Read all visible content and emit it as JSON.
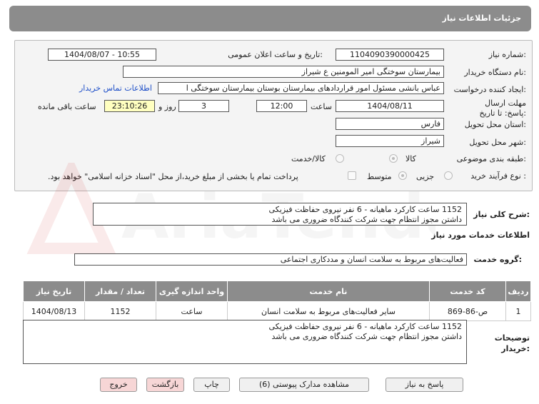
{
  "header": {
    "title": "جزئیات اطلاعات نیاز"
  },
  "fields": {
    "need_number_label": "شماره نیاز:",
    "need_number": "1104090390000425",
    "announce_label": "تاریخ و ساعت اعلان عمومی:",
    "announce_value": "1404/08/07 - 10:55",
    "buyer_org_label": "نام دستگاه خریدار:",
    "buyer_org": "بیمارستان سوختگی امیر المومنین  ع  شیراز",
    "requester_label": "ایجاد کننده درخواست:",
    "requester": "عباس بانشی مسئول امور قراردادهای بیمارستان بوستان بیمارستان سوختگی ا",
    "contact_link": "اطلاعات تماس خریدار",
    "deadline_label": "مهلت ارسال پاسخ: تا تاریخ:",
    "deadline_date": "1404/08/11",
    "time_label": "ساعت",
    "deadline_time": "12:00",
    "days_value": "3",
    "days_label": "روز و",
    "countdown": "23:10:26",
    "remaining_label": "ساعت باقی مانده",
    "province_label": "استان محل تحویل:",
    "province": "فارس",
    "city_label": "شهر محل تحویل:",
    "city": "شیراز",
    "category_label": "طبقه بندی موضوعی:",
    "cat_goods": "کالا",
    "cat_goods_service": "کالا/خدمت",
    "process_label": "نوع فرآیند خرید :",
    "proc_partial": "جزیی",
    "proc_medium": "متوسط",
    "treasury_note": "پرداخت تمام یا بخشی از مبلغ خرید،از محل \"اسناد خزانه اسلامی\" خواهد بود."
  },
  "summary": {
    "label": "شرح کلی نیاز:",
    "line1": "1152 ساعت کارکرد ماهیانه - 6 نفر نیروی حفاظت فیزیکی",
    "line2": "داشتن مجوز انتظام جهت شرکت کنندگاه ضروری می باشد"
  },
  "services": {
    "section_title": "اطلاعات خدمات مورد نیاز",
    "group_label": "گروه خدمت:",
    "group_value": "فعالیت‌های مربوط به سلامت انسان و مددکاری اجتماعی"
  },
  "table": {
    "headers": [
      "ردیف",
      "کد خدمت",
      "نام خدمت",
      "واحد اندازه گیری",
      "تعداد / مقدار",
      "تاریخ نیاز"
    ],
    "rows": [
      [
        "1",
        "ص-86-869",
        "سایر فعالیت‌های مربوط به سلامت انسان",
        "ساعت",
        "1152",
        "1404/08/13"
      ]
    ]
  },
  "notes": {
    "label": "توضیحات خریدار:",
    "line1": "1152 ساعت کارکرد ماهیانه - 6 نفر نیروی حفاظت فیزیکی",
    "line2": "داشتن مجوز انتظام جهت شرکت کنندگاه ضروری می باشد"
  },
  "buttons": {
    "reply": "پاسخ به نیاز",
    "attachments": "مشاهده مدارک پیوستی (6)",
    "print": "چاپ",
    "back": "بازگشت",
    "exit": "خروج"
  },
  "watermark": {
    "text": "AriaTender.net"
  },
  "colors": {
    "header_bg": "#8c8c8c",
    "link": "#1e4fc8",
    "countdown_bg": "#ffffc0",
    "btn_pink": "#f7d6d6"
  }
}
